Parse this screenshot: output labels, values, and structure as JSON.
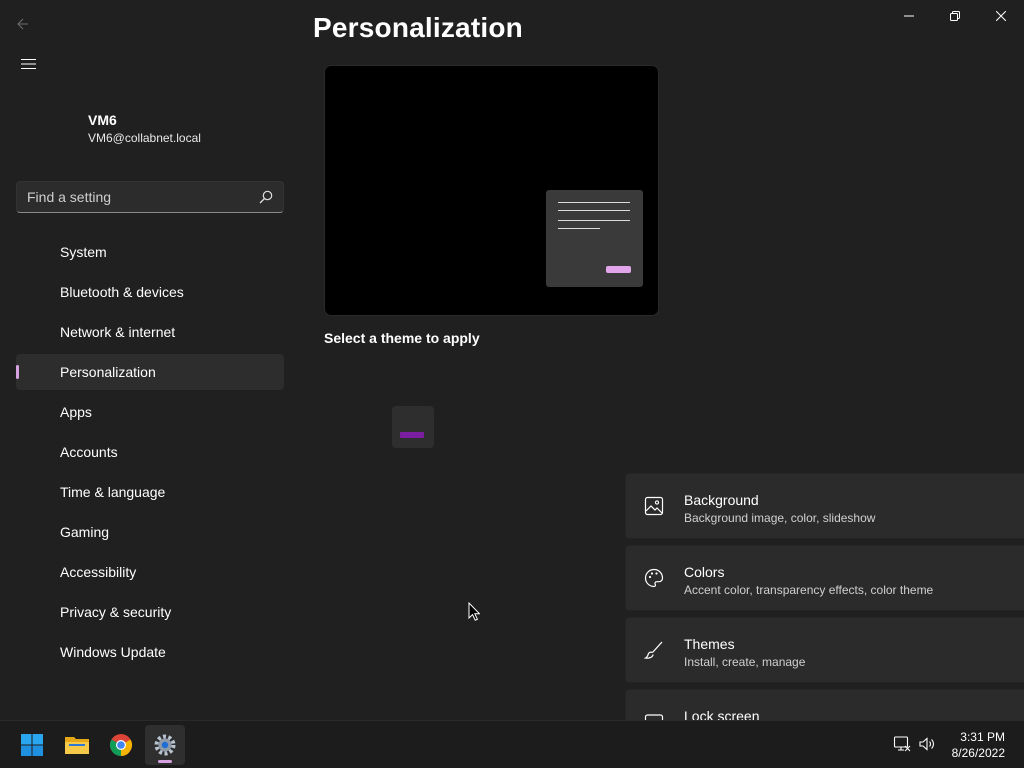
{
  "window": {
    "page_title": "Personalization",
    "controls": [
      "minimize",
      "restore",
      "close"
    ]
  },
  "user": {
    "name": "VM6",
    "email": "VM6@collabnet.local"
  },
  "search": {
    "placeholder": "Find a setting"
  },
  "nav": {
    "items": [
      {
        "label": "System"
      },
      {
        "label": "Bluetooth & devices"
      },
      {
        "label": "Network & internet"
      },
      {
        "label": "Personalization",
        "active": true
      },
      {
        "label": "Apps"
      },
      {
        "label": "Accounts"
      },
      {
        "label": "Time & language"
      },
      {
        "label": "Gaming"
      },
      {
        "label": "Accessibility"
      },
      {
        "label": "Privacy & security"
      },
      {
        "label": "Windows Update"
      }
    ]
  },
  "main": {
    "themes_label": "Select a theme to apply",
    "cards": [
      {
        "title": "Background",
        "subtitle": "Background image, color, slideshow",
        "icon": "image-icon"
      },
      {
        "title": "Colors",
        "subtitle": "Accent color, transparency effects, color theme",
        "icon": "palette-icon"
      },
      {
        "title": "Themes",
        "subtitle": "Install, create, manage",
        "icon": "brush-icon"
      },
      {
        "title": "Lock screen",
        "subtitle": "",
        "icon": "lock-screen-icon"
      }
    ]
  },
  "taskbar": {
    "apps": [
      "windows-start-icon",
      "file-explorer-icon",
      "chrome-icon",
      "settings-icon"
    ],
    "time": "3:31 PM",
    "date": "8/26/2022"
  },
  "colors": {
    "accent": "#d6a2e0",
    "background": "#202020",
    "card": "#2b2b2b",
    "theme_bar": "#7a1fa2"
  }
}
